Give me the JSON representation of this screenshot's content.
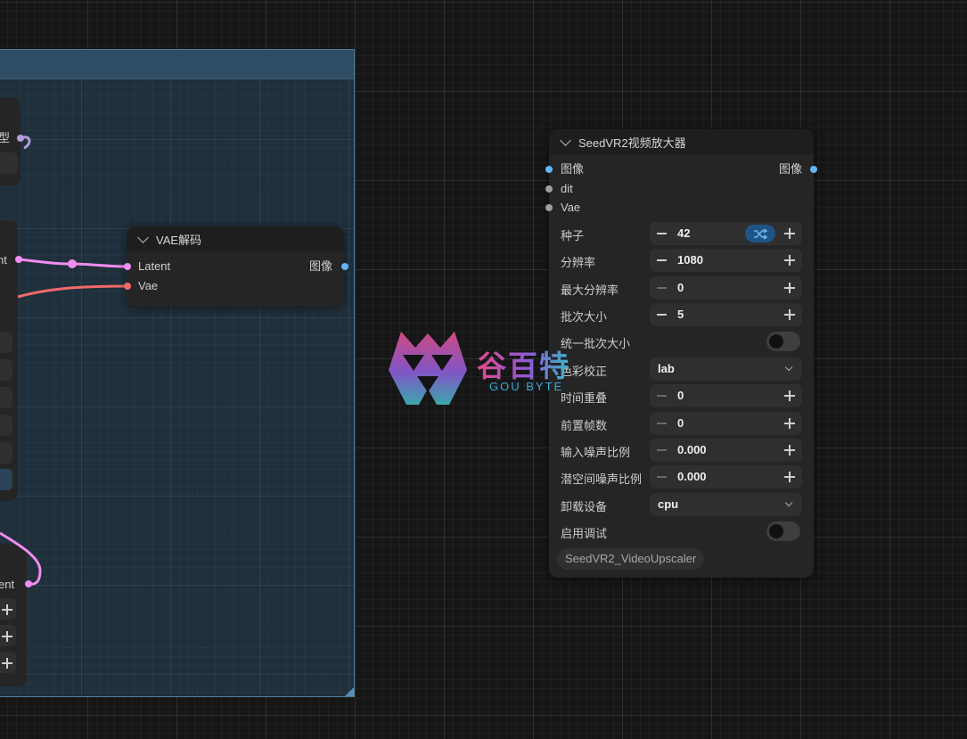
{
  "wires_colors": {
    "latent": "#f28cf0",
    "vae": "#f06a6a",
    "image": "#64b5f6"
  },
  "left_partial": {
    "model_label": "型",
    "latent_label": "nt",
    "bottom_latent_label": "ent"
  },
  "vae_decode": {
    "title": "VAE解码",
    "inputs": [
      "Latent",
      "Vae"
    ],
    "output": "图像"
  },
  "seedvr2": {
    "title": "SeedVR2视频放大器",
    "inputs": [
      "图像",
      "dit",
      "Vae"
    ],
    "output": "图像",
    "widgets": {
      "seed": {
        "label": "种子",
        "value": "42"
      },
      "resolution": {
        "label": "分辨率",
        "value": "1080"
      },
      "max_resolution": {
        "label": "最大分辨率",
        "value": "0"
      },
      "batch_size": {
        "label": "批次大小",
        "value": "5"
      },
      "uniform_batch": {
        "label": "统一批次大小",
        "value": false
      },
      "color_correction": {
        "label": "色彩校正",
        "value": "lab"
      },
      "temporal_overlap": {
        "label": "时间重叠",
        "value": "0"
      },
      "prepend_frames": {
        "label": "前置帧数",
        "value": "0"
      },
      "input_noise_scale": {
        "label": "输入噪声比例",
        "value": "0.000"
      },
      "latent_noise_scale": {
        "label": "潜空间噪声比例",
        "value": "0.000"
      },
      "offload_device": {
        "label": "卸载设备",
        "value": "cpu"
      },
      "enable_debug": {
        "label": "启用调试",
        "value": false
      }
    },
    "node_type_badge": "SeedVR2_VideoUpscaler"
  },
  "watermark": {
    "cn": "谷百特",
    "en": "GOU BYTE"
  }
}
